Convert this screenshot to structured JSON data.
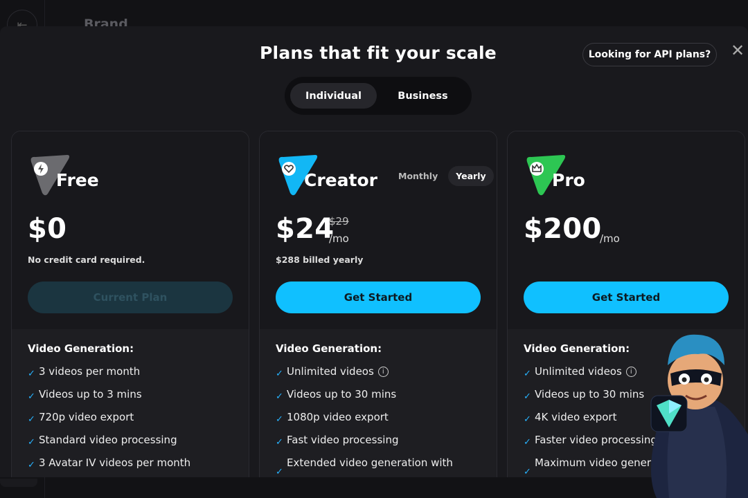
{
  "background": {
    "title": "Brand",
    "back_icon": "arrow-left-icon"
  },
  "modal": {
    "title": "Plans that fit your scale",
    "api_button": "Looking for API plans?",
    "close_icon": "close-icon",
    "tabs": [
      {
        "label": "Individual",
        "active": true
      },
      {
        "label": "Business",
        "active": false
      }
    ]
  },
  "plans": [
    {
      "name": "Free",
      "icon": "lightning-icon",
      "color": "#6b6b6f",
      "price": "$0",
      "note": "No credit card required.",
      "cta": "Current Plan",
      "features_title": "Video Generation:",
      "features": [
        "3 videos per month",
        "Videos up to 3 mins",
        "720p video export",
        "Standard video processing",
        "3 Avatar IV videos per month"
      ]
    },
    {
      "name": "Creator",
      "icon": "heart-icon",
      "color": "#12b7f5",
      "price": "$24",
      "old_price": "$29",
      "per": "/mo",
      "note": "$288 billed yearly",
      "billing": [
        "Monthly",
        "Yearly"
      ],
      "billing_selected": "Yearly",
      "cta": "Get Started",
      "features_title": "Video Generation:",
      "features": [
        "Unlimited videos",
        "Videos up to 30 mins",
        "1080p video export",
        "Fast video processing",
        "Extended video generation with"
      ]
    },
    {
      "name": "Pro",
      "icon": "crown-icon",
      "color": "#2dc653",
      "price": "$200",
      "per": "/mo",
      "cta": "Get Started",
      "features_title": "Video Generation:",
      "features": [
        "Unlimited videos",
        "Videos up to 30 mins",
        "4K video export",
        "Faster video processing",
        "Maximum video generation with"
      ]
    }
  ],
  "accent_color": "#10c0ff"
}
